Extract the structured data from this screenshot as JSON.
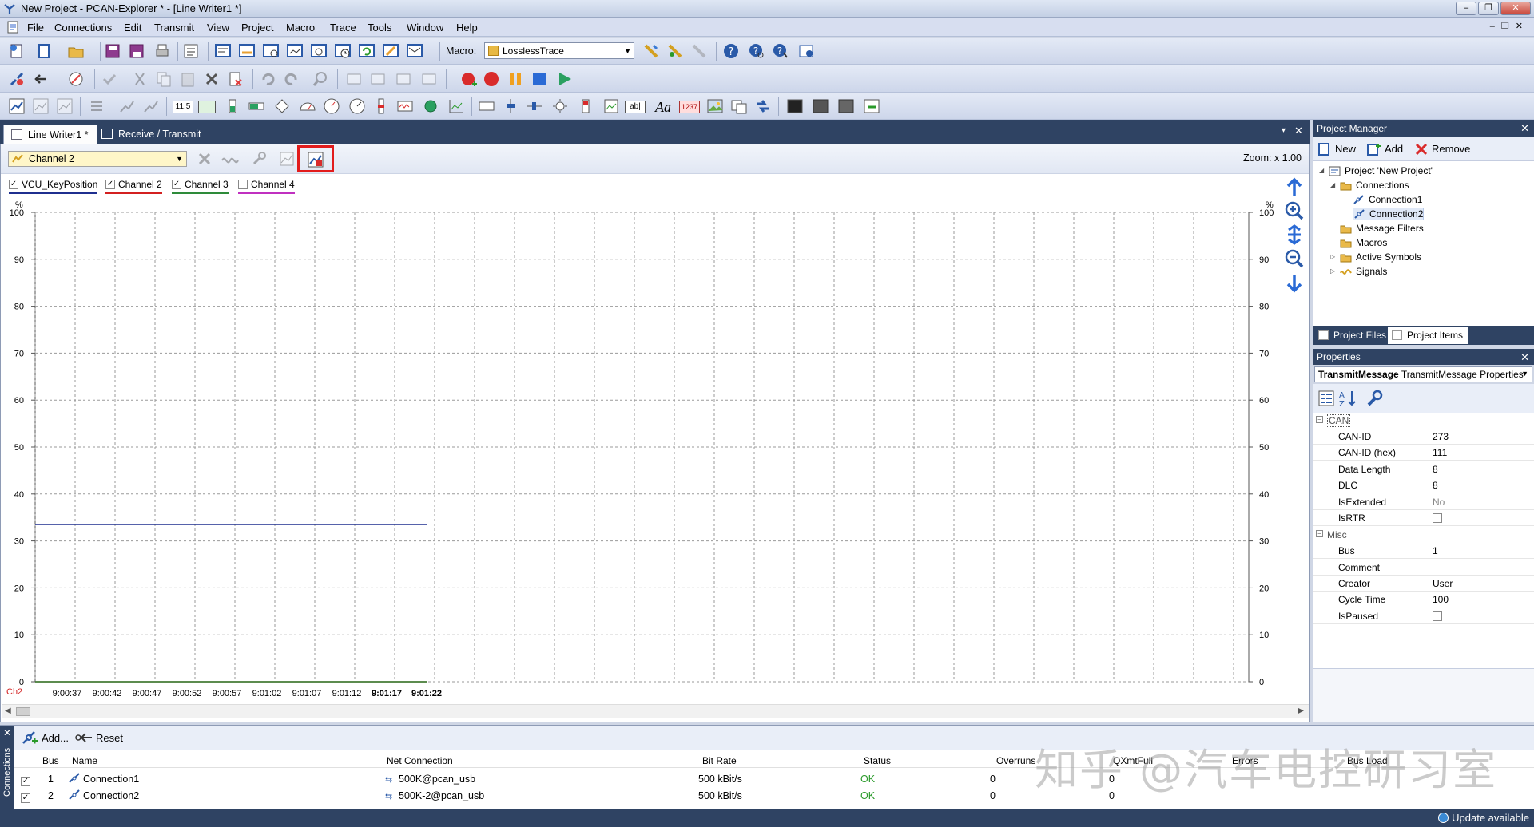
{
  "window": {
    "title": "New Project - PCAN-Explorer * - [Line Writer1 *]"
  },
  "menu": [
    "File",
    "Connections",
    "Edit",
    "Transmit",
    "View",
    "Project",
    "Macro",
    "Trace",
    "Tools",
    "Window",
    "Help"
  ],
  "macro": {
    "label": "Macro:",
    "value": "LosslessTrace"
  },
  "toolbar3_labels": {
    "num1": "11.5",
    "num2": "1237"
  },
  "tabs": [
    {
      "label": "Line Writer1 *"
    },
    {
      "label": "Receive / Transmit"
    }
  ],
  "linewriter": {
    "channel_selected": "Channel 2",
    "zoom": "Zoom:  x 1.00",
    "legend": [
      {
        "label": "VCU_KeyPosition",
        "checked": true,
        "color": "#1f2f8f"
      },
      {
        "label": "Channel 2",
        "checked": true,
        "color": "#d32020"
      },
      {
        "label": "Channel 3",
        "checked": true,
        "color": "#2e8b3a"
      },
      {
        "label": "Channel 4",
        "checked": false,
        "color": "#c030c0"
      }
    ],
    "axis_label_ch": "Ch2"
  },
  "chart_data": {
    "type": "line",
    "ylabel_left": "%",
    "ylabel_right": "%",
    "ylim": [
      0,
      100
    ],
    "yticks": [
      0,
      10,
      20,
      30,
      40,
      50,
      60,
      70,
      80,
      90,
      100
    ],
    "x_ticks": [
      "9:00:37",
      "9:00:42",
      "9:00:47",
      "9:00:52",
      "9:00:57",
      "9:01:02",
      "9:01:07",
      "9:01:12",
      "9:01:17",
      "9:01:22"
    ],
    "grid": true,
    "series": [
      {
        "name": "VCU_KeyPosition",
        "color": "#1f2f8f",
        "x": [
          "9:00:33",
          "9:01:22"
        ],
        "values": [
          33.5,
          33.5
        ]
      },
      {
        "name": "Channel 2",
        "color": "#d32020",
        "x": [
          "9:00:33",
          "9:01:22"
        ],
        "values": [
          0,
          0
        ]
      },
      {
        "name": "Channel 3",
        "color": "#2e8b3a",
        "x": [
          "9:00:33",
          "9:01:22"
        ],
        "values": [
          0,
          0
        ]
      }
    ]
  },
  "project_manager": {
    "title": "Project Manager",
    "new": "New",
    "add": "Add",
    "remove": "Remove",
    "tree": [
      "Project 'New Project'",
      "Connections",
      "Connection1",
      "Connection2",
      "Message Filters",
      "Macros",
      "Active Symbols",
      "Signals"
    ],
    "tab_files": "Project Files",
    "tab_items": "Project Items"
  },
  "properties": {
    "title": "Properties",
    "object_type": "TransmitMessage",
    "object_desc": "TransmitMessage Properties",
    "cat_can": "CAN",
    "cat_misc": "Misc",
    "can_rows": [
      {
        "k": "CAN-ID",
        "v": "273"
      },
      {
        "k": "CAN-ID (hex)",
        "v": "111"
      },
      {
        "k": "Data Length",
        "v": "8"
      },
      {
        "k": "DLC",
        "v": "8"
      },
      {
        "k": "IsExtended",
        "v": "No"
      },
      {
        "k": "IsRTR",
        "v": ""
      }
    ],
    "misc_rows": [
      {
        "k": "Bus",
        "v": "1"
      },
      {
        "k": "Comment",
        "v": ""
      },
      {
        "k": "Creator",
        "v": "User"
      },
      {
        "k": "Cycle Time",
        "v": "100"
      },
      {
        "k": "IsPaused",
        "v": ""
      }
    ]
  },
  "connections": {
    "side_label": "Connections",
    "add": "Add...",
    "reset": "Reset",
    "headers": [
      "Bus",
      "Name",
      "Net Connection",
      "Bit Rate",
      "Status",
      "Overruns",
      "QXmtFull",
      "Errors",
      "Bus Load"
    ],
    "rows": [
      {
        "bus": "1",
        "name": "Connection1",
        "net": "500K@pcan_usb",
        "rate": "500 kBit/s",
        "status": "OK",
        "overruns": "0",
        "qxmt": "0"
      },
      {
        "bus": "2",
        "name": "Connection2",
        "net": "500K-2@pcan_usb",
        "rate": "500 kBit/s",
        "status": "OK",
        "overruns": "0",
        "qxmt": "0"
      }
    ]
  },
  "watermark": "知乎 @汽车电控研习室",
  "status": {
    "update": "Update available"
  }
}
